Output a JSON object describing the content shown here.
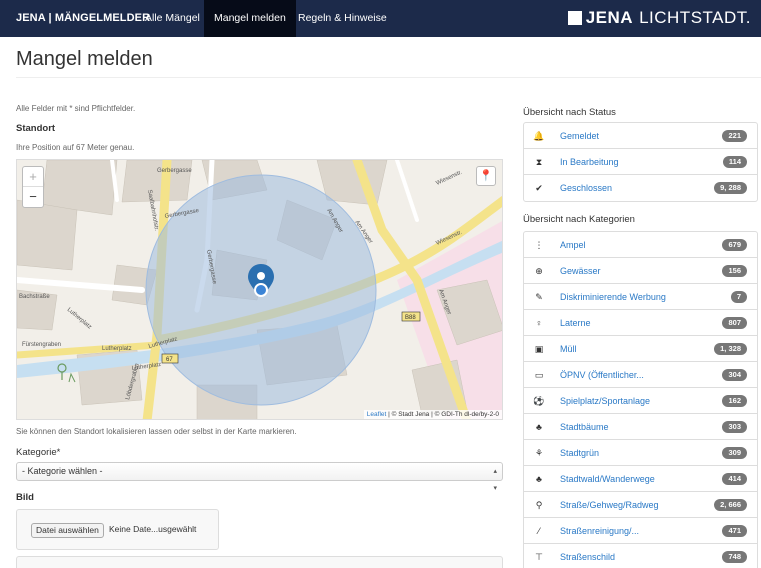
{
  "nav": {
    "brand": "JENA | MÄNGELMELDER",
    "items": [
      "Alle Mängel",
      "Mangel melden",
      "Regeln & Hinweise"
    ],
    "logo_jena": "JENA",
    "logo_licht": "LICHTSTADT."
  },
  "page": {
    "title": "Mangel melden",
    "required_hint": "Alle Felder mit * sind Pflichtfelder.",
    "standort_label": "Standort",
    "position_text": "Ihre Position auf 67 Meter genau.",
    "map_hint": "Sie können den Standort lokalisieren lassen oder selbst in der Karte markieren.",
    "kategorie_label": "Kategorie*",
    "kategorie_value": "- Kategorie wählen -",
    "bild_label": "Bild",
    "file_button": "Datei auswählen",
    "file_text": "Keine Date...usgewählt"
  },
  "map": {
    "zoom_in": "+",
    "zoom_out": "−",
    "attribution_leaflet": "Leaflet",
    "attribution_rest": " | © Stadt Jena | © GDI-Th dl-de/by-2-0",
    "labels": {
      "gerbergasse1": "Gerbergasse",
      "gerbergasse2": "Gerbergasse",
      "gerbergasse3": "Gerbergasse",
      "wiesenstr1": "Wiesenstr.",
      "wiesenstr2": "Wiesenstr.",
      "am_anger1": "Am Anger",
      "am_anger2": "Am Anger",
      "am_anger3": "Am Anger",
      "lutherplatz1": "Lutherplatz",
      "lutherplatz2": "Lutherplatz",
      "lutherplatz3": "Lutherplatz",
      "lutherplatz4": "Lutherplatz",
      "fuerstengraben": "Fürstengraben",
      "bachstrasse": "Bachstraße",
      "loebdergraben": "Löbdergraben",
      "saalbahnhofstr": "Saalbahnhofstr.",
      "r88": "B88",
      "r67": "67"
    }
  },
  "status": {
    "title": "Übersicht nach Status",
    "items": [
      {
        "icon": "bell-icon",
        "glyph": "🔔",
        "label": "Gemeldet",
        "count": "221"
      },
      {
        "icon": "hourglass-icon",
        "glyph": "⧗",
        "label": "In Bearbeitung",
        "count": "114"
      },
      {
        "icon": "check-icon",
        "glyph": "✔",
        "label": "Geschlossen",
        "count": "9, 288"
      }
    ]
  },
  "categories": {
    "title": "Übersicht nach Kategorien",
    "items": [
      {
        "icon": "traffic-light-icon",
        "glyph": "⋮",
        "label": "Ampel",
        "count": "679"
      },
      {
        "icon": "lifebuoy-icon",
        "glyph": "⊕",
        "label": "Gewässer",
        "count": "156"
      },
      {
        "icon": "pin-icon",
        "glyph": "✎",
        "label": "Diskriminierende Werbung",
        "count": "7"
      },
      {
        "icon": "lightbulb-icon",
        "glyph": "♀",
        "label": "Laterne",
        "count": "807"
      },
      {
        "icon": "trash-icon",
        "glyph": "▣",
        "label": "Müll",
        "count": "1, 328"
      },
      {
        "icon": "bus-icon",
        "glyph": "▭",
        "label": "ÖPNV (Öffentlicher...",
        "count": "304"
      },
      {
        "icon": "ball-icon",
        "glyph": "⚽",
        "label": "Spielplatz/Sportanlage",
        "count": "162"
      },
      {
        "icon": "tree-icon",
        "glyph": "♣",
        "label": "Stadtbäume",
        "count": "303"
      },
      {
        "icon": "plant-icon",
        "glyph": "⚘",
        "label": "Stadtgrün",
        "count": "309"
      },
      {
        "icon": "forest-icon",
        "glyph": "♣",
        "label": "Stadtwald/Wanderwege",
        "count": "414"
      },
      {
        "icon": "bicycle-icon",
        "glyph": "⚲",
        "label": "Straße/Gehweg/Radweg",
        "count": "2, 666"
      },
      {
        "icon": "broom-icon",
        "glyph": "⁄",
        "label": "Straßenreinigung/...",
        "count": "471"
      },
      {
        "icon": "signpost-icon",
        "glyph": "⊤",
        "label": "Straßenschild",
        "count": "748"
      }
    ]
  }
}
